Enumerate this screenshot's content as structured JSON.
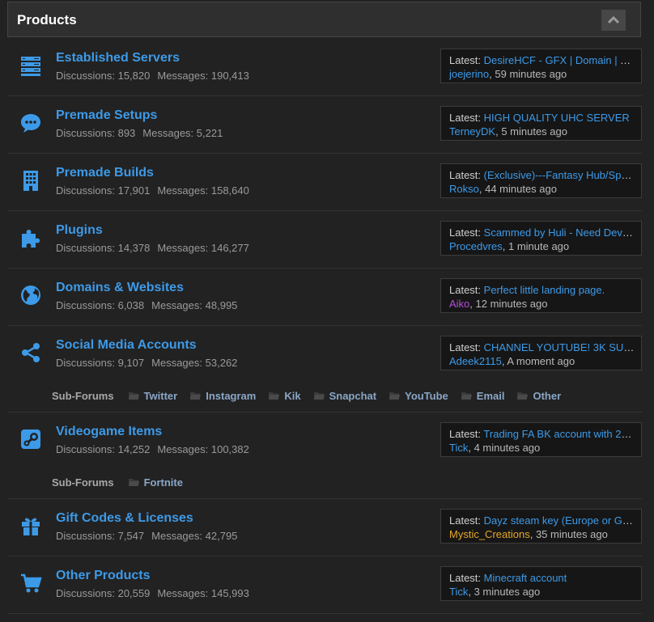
{
  "header": {
    "title": "Products"
  },
  "colors": {
    "link": "#3d9ae8",
    "purple_user": "#b44fd8",
    "gold_user": "#e4a72a"
  },
  "forums": [
    {
      "icon": "server-icon",
      "title": "Established Servers",
      "discussions_label": "Discussions:",
      "discussions": "15,820",
      "messages_label": "Messages:",
      "messages": "190,413",
      "latest_label": "Latest:",
      "latest_thread": "DesireHCF - GFX | Domain | Tw…",
      "latest_user": "joejerino",
      "latest_time": "59 minutes ago"
    },
    {
      "icon": "speech-bubble-icon",
      "title": "Premade Setups",
      "discussions_label": "Discussions:",
      "discussions": "893",
      "messages_label": "Messages:",
      "messages": "5,221",
      "latest_label": "Latest:",
      "latest_thread": "HIGH QUALITY UHC SERVER",
      "latest_user": "TerneyDK",
      "latest_time": "5 minutes ago"
    },
    {
      "icon": "building-icon",
      "title": "Premade Builds",
      "discussions_label": "Discussions:",
      "discussions": "17,901",
      "messages_label": "Messages:",
      "messages": "158,640",
      "latest_label": "Latest:",
      "latest_thread": "(Exclusive)---Fantasy Hub/Spa…",
      "latest_user": "Rokso",
      "latest_time": "44 minutes ago"
    },
    {
      "icon": "puzzle-icon",
      "title": "Plugins",
      "discussions_label": "Discussions:",
      "discussions": "14,378",
      "messages_label": "Messages:",
      "messages": "146,277",
      "latest_label": "Latest:",
      "latest_thread": "Scammed by Huli - Need Devel…",
      "latest_user": "Procedvres",
      "latest_time": "1 minute ago"
    },
    {
      "icon": "globe-icon",
      "title": "Domains & Websites",
      "discussions_label": "Discussions:",
      "discussions": "6,038",
      "messages_label": "Messages:",
      "messages": "48,995",
      "latest_label": "Latest:",
      "latest_thread": "Perfect little landing page.",
      "latest_user": "Aiko",
      "latest_time": "12 minutes ago"
    },
    {
      "icon": "share-icon",
      "title": "Social Media Accounts",
      "discussions_label": "Discussions:",
      "discussions": "9,107",
      "messages_label": "Messages:",
      "messages": "53,262",
      "latest_label": "Latest:",
      "latest_thread": "CHANNEL YOUTUBE! 3K SUBS",
      "latest_user": "Adeek2115",
      "latest_time": "A moment ago",
      "subforums_label": "Sub-Forums",
      "subforums": [
        "Twitter",
        "Instagram",
        "Kik",
        "Snapchat",
        "YouTube",
        "Email",
        "Other"
      ]
    },
    {
      "icon": "steam-icon",
      "title": "Videogame Items",
      "discussions_label": "Discussions:",
      "discussions": "14,252",
      "messages_label": "Messages:",
      "messages": "100,382",
      "latest_label": "Latest:",
      "latest_thread": "Trading FA BK account with 20…",
      "latest_user": "Tick",
      "latest_time": "4 minutes ago",
      "subforums_label": "Sub-Forums",
      "subforums": [
        "Fortnite"
      ]
    },
    {
      "icon": "gift-icon",
      "title": "Gift Codes & Licenses",
      "discussions_label": "Discussions:",
      "discussions": "7,547",
      "messages_label": "Messages:",
      "messages": "42,795",
      "latest_label": "Latest:",
      "latest_thread": "Dayz steam key (Europe or Glo…",
      "latest_user": "Mystic_Creations",
      "latest_time": "35 minutes ago"
    },
    {
      "icon": "shopping-cart-icon",
      "title": "Other Products",
      "discussions_label": "Discussions:",
      "discussions": "20,559",
      "messages_label": "Messages:",
      "messages": "145,993",
      "latest_label": "Latest:",
      "latest_thread": "Minecraft account",
      "latest_user": "Tick",
      "latest_time": "3 minutes ago"
    }
  ]
}
